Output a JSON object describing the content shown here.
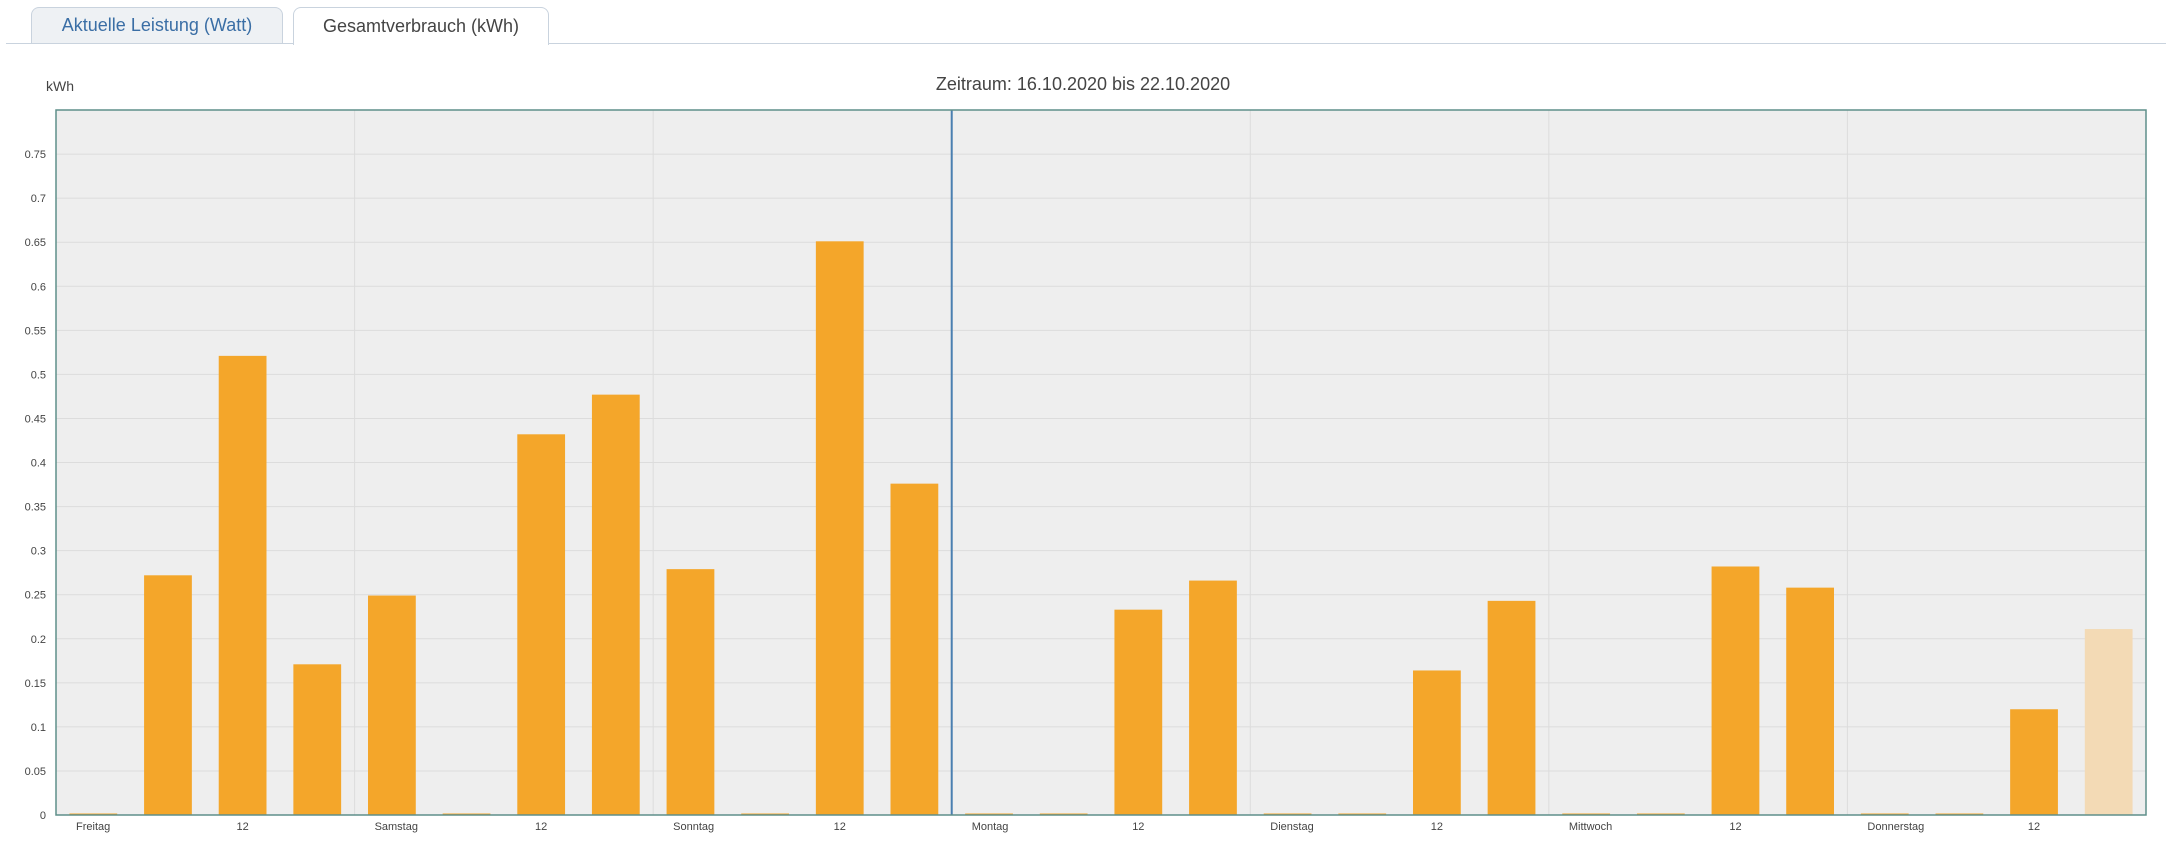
{
  "tabs": [
    {
      "label": "Aktuelle Leistung (Watt)",
      "active": false
    },
    {
      "label": "Gesamtverbrauch (kWh)",
      "active": true
    }
  ],
  "chart_data": {
    "type": "bar",
    "title": "Zeitraum: 16.10.2020 bis 22.10.2020",
    "ylabel": "kWh",
    "xlabel": "",
    "ylim": [
      0,
      0.8
    ],
    "yticks": [
      "0",
      "0.05",
      "0.1",
      "0.15",
      "0.2",
      "0.25",
      "0.3",
      "0.35",
      "0.4",
      "0.45",
      "0.5",
      "0.55",
      "0.6",
      "0.65",
      "0.7",
      "0.75"
    ],
    "grid": true,
    "bars_per_day": 4,
    "day_labels": [
      "Freitag",
      "Samstag",
      "Sonntag",
      "Montag",
      "Dienstag",
      "Mittwoch",
      "Donnerstag"
    ],
    "midday_label": "12",
    "values": [
      0,
      0.272,
      0.521,
      0.171,
      0.249,
      0,
      0.432,
      0.477,
      0.279,
      0,
      0.651,
      0.376,
      0,
      0,
      0.233,
      0.266,
      0,
      0,
      0.164,
      0.243,
      0,
      0,
      0.282,
      0.258,
      0,
      0,
      0.12,
      0.211
    ],
    "incomplete_last_bar": true,
    "divider_after_day": 2,
    "colors": {
      "bar": "#f4a62a",
      "bar_incomplete": "#f3dab5",
      "plot_bg": "#eeeeee",
      "grid": "#dcdcdc",
      "frame": "#5f8f8a",
      "divider": "#4a7fb0",
      "text": "#444444"
    }
  }
}
